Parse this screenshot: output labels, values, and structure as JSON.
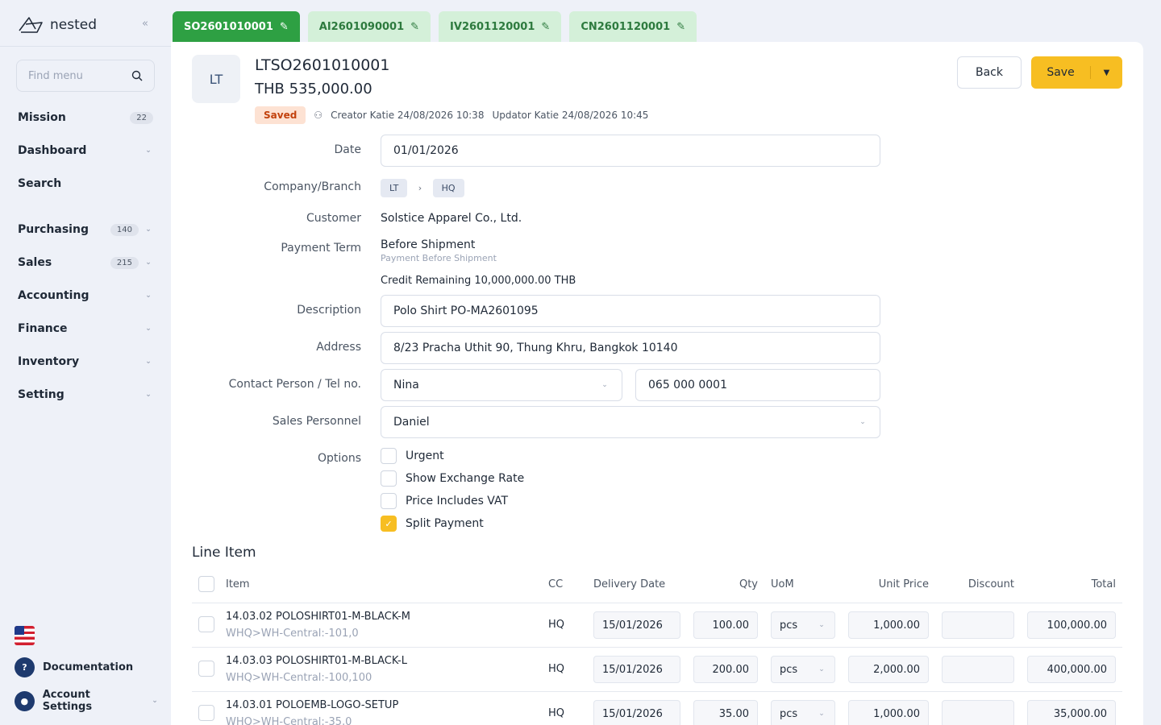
{
  "sidebar": {
    "logo": "nested",
    "search_placeholder": "Find menu",
    "items": [
      {
        "label": "Mission",
        "badge": "22",
        "chevron": false
      },
      {
        "label": "Dashboard",
        "badge": "",
        "chevron": true
      },
      {
        "label": "Search",
        "badge": "",
        "chevron": false
      },
      {
        "label": "Purchasing",
        "badge": "140",
        "chevron": true
      },
      {
        "label": "Sales",
        "badge": "215",
        "chevron": true
      },
      {
        "label": "Accounting",
        "badge": "",
        "chevron": true
      },
      {
        "label": "Finance",
        "badge": "",
        "chevron": true
      },
      {
        "label": "Inventory",
        "badge": "",
        "chevron": true
      },
      {
        "label": "Setting",
        "badge": "",
        "chevron": true
      }
    ],
    "documentation": "Documentation",
    "account_settings": "Account Settings"
  },
  "tabs": [
    "SO2601010001",
    "AI2601090001",
    "IV2601120001",
    "CN2601120001"
  ],
  "doc": {
    "avatar": "LT",
    "title": "LTSO2601010001",
    "amount": "THB 535,000.00",
    "status": "Saved",
    "creator": "Creator Katie 24/08/2026 10:38",
    "updator": "Updator Katie 24/08/2026 10:45"
  },
  "actions": {
    "back": "Back",
    "save": "Save"
  },
  "form": {
    "date_label": "Date",
    "date": "01/01/2026",
    "company_label": "Company/Branch",
    "company": "LT",
    "branch": "HQ",
    "customer_label": "Customer",
    "customer": "Solstice Apparel Co., Ltd.",
    "payment_term_label": "Payment Term",
    "payment_term": "Before Shipment",
    "payment_term_sub": "Payment Before Shipment",
    "credit_remaining": "Credit Remaining 10,000,000.00 THB",
    "description_label": "Description",
    "description": "Polo Shirt PO-MA2601095",
    "address_label": "Address",
    "address": "8/23 Pracha Uthit 90, Thung Khru, Bangkok 10140",
    "contact_label": "Contact Person / Tel no.",
    "contact": "Nina",
    "tel": "065 000 0001",
    "sales_label": "Sales Personnel",
    "sales": "Daniel",
    "options_label": "Options",
    "options": [
      {
        "label": "Urgent",
        "checked": false
      },
      {
        "label": "Show Exchange Rate",
        "checked": false
      },
      {
        "label": "Price Includes VAT",
        "checked": false
      },
      {
        "label": "Split Payment",
        "checked": true
      }
    ]
  },
  "line_items": {
    "title": "Line Item",
    "headers": {
      "item": "Item",
      "cc": "CC",
      "delivery": "Delivery Date",
      "qty": "Qty",
      "uom": "UoM",
      "unit_price": "Unit Price",
      "discount": "Discount",
      "total": "Total"
    },
    "rows": [
      {
        "item": "14.03.02 POLOSHIRT01-M-BLACK-M",
        "sub": "WHQ>WH-Central:-101,0",
        "cc": "HQ",
        "delivery": "15/01/2026",
        "qty": "100.00",
        "uom": "pcs",
        "unit_price": "1,000.00",
        "discount": "",
        "total": "100,000.00"
      },
      {
        "item": "14.03.03 POLOSHIRT01-M-BLACK-L",
        "sub": "WHQ>WH-Central:-100,100",
        "cc": "HQ",
        "delivery": "15/01/2026",
        "qty": "200.00",
        "uom": "pcs",
        "unit_price": "2,000.00",
        "discount": "",
        "total": "400,000.00"
      },
      {
        "item": "14.03.01 POLOEMB-LOGO-SETUP",
        "sub": "WHQ>WH-Central:-35,0",
        "cc": "HQ",
        "delivery": "15/01/2026",
        "qty": "35.00",
        "uom": "pcs",
        "unit_price": "1,000.00",
        "discount": "",
        "total": "35,000.00"
      }
    ]
  }
}
